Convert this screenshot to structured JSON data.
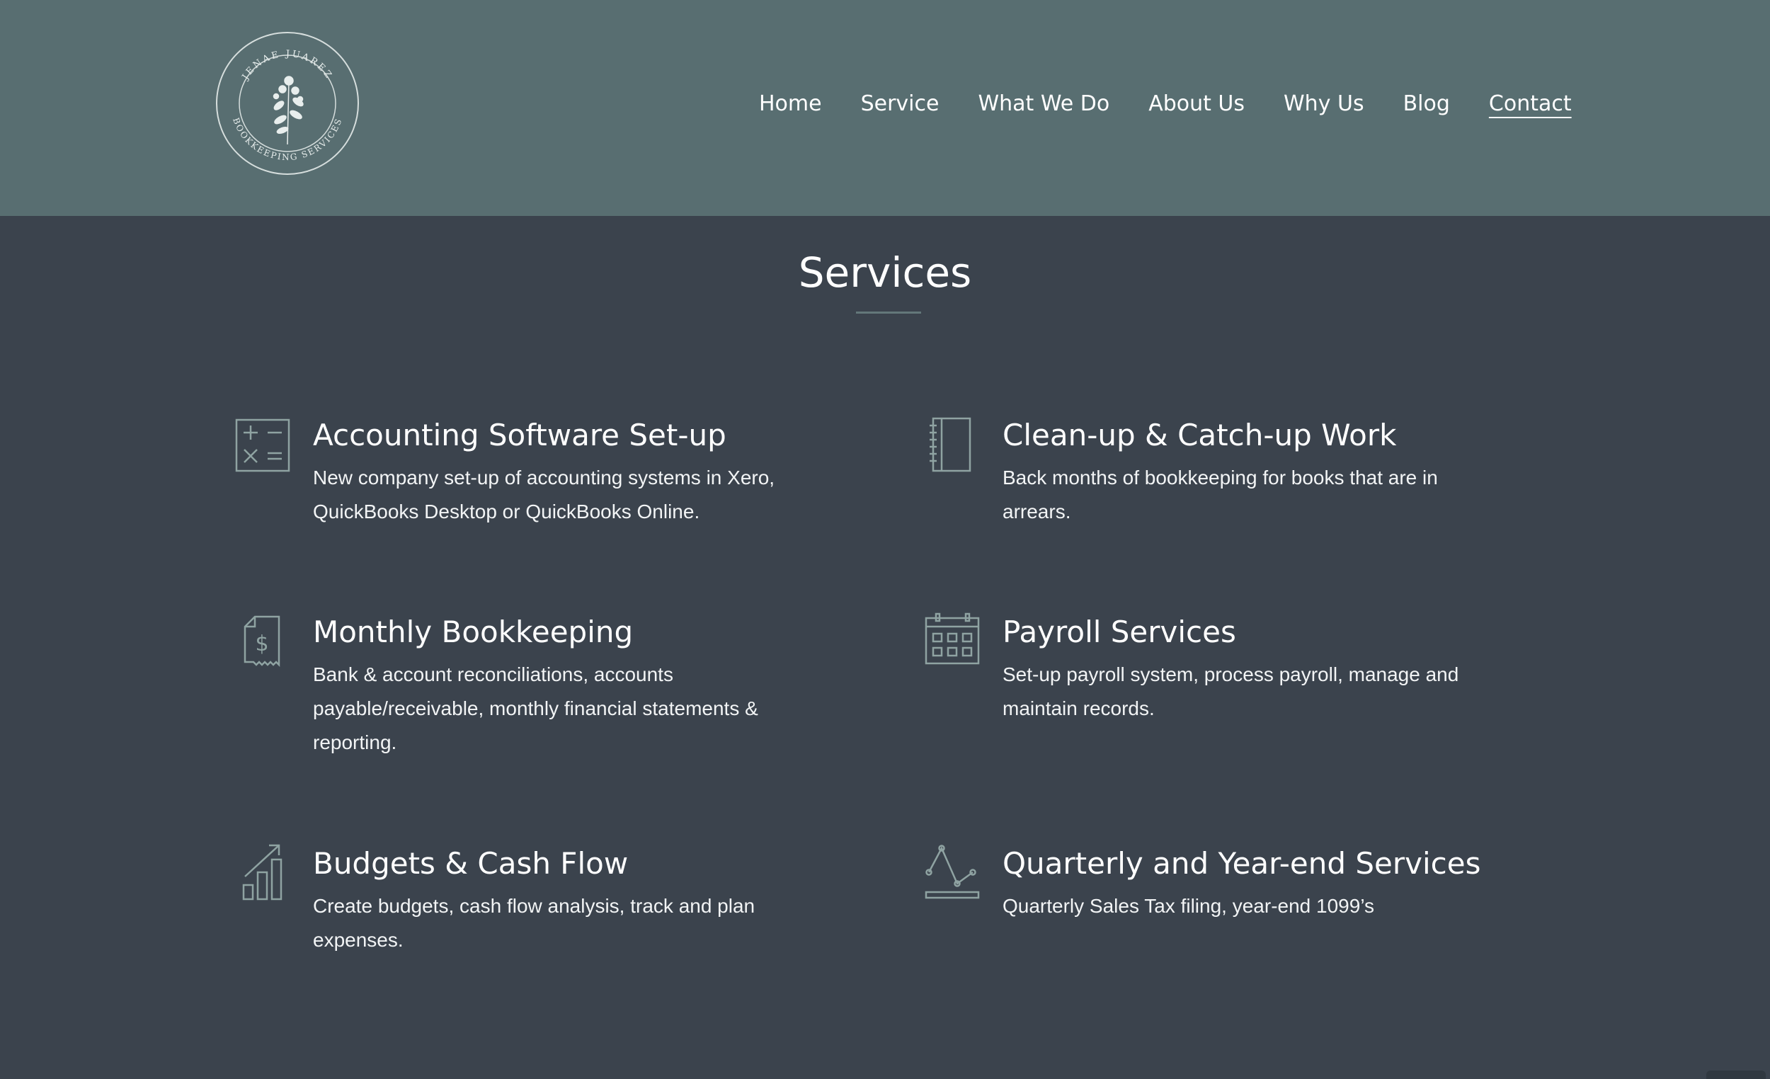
{
  "brand": {
    "logo_text_top": "JENAE JUAREZ",
    "logo_text_bottom": "BOOKKEEPING SERVICES",
    "logo_icon": "flower-sprig-icon"
  },
  "nav": {
    "items": [
      {
        "label": "Home"
      },
      {
        "label": "Service"
      },
      {
        "label": "What We Do"
      },
      {
        "label": "About Us"
      },
      {
        "label": "Why Us"
      },
      {
        "label": "Blog"
      },
      {
        "label": "Contact",
        "active": true
      }
    ]
  },
  "section": {
    "title": "Services"
  },
  "services": [
    {
      "icon": "calculator-icon",
      "title": "Accounting Software Set-up",
      "description": "New company set-up of accounting systems in Xero, QuickBooks Desktop or QuickBooks Online."
    },
    {
      "icon": "notebook-icon",
      "title": "Clean-up & Catch-up Work",
      "description": "Back months of bookkeeping for books that are in arrears."
    },
    {
      "icon": "invoice-dollar-icon",
      "title": "Monthly Bookkeeping",
      "description": "Bank & account reconciliations, accounts payable/receivable, monthly financial statements & reporting."
    },
    {
      "icon": "calendar-icon",
      "title": "Payroll Services",
      "description": "Set-up payroll system, process payroll, manage and maintain records."
    },
    {
      "icon": "bar-chart-growth-icon",
      "title": "Budgets & Cash Flow",
      "description": "Create budgets, cash flow analysis, track and plan expenses."
    },
    {
      "icon": "line-chart-icon",
      "title": "Quarterly and Year-end Services",
      "description": "Quarterly Sales Tax filing, year-end 1099’s"
    }
  ],
  "colors": {
    "header_bg": "#586e71",
    "page_bg": "#3b434d",
    "icon_stroke": "#8fa3a2",
    "text": "#ffffff"
  }
}
